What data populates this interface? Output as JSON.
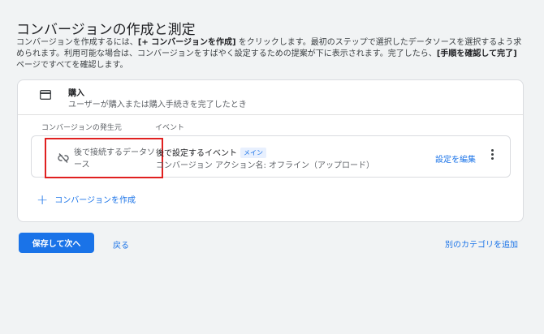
{
  "page": {
    "title": "コンバージョンの作成と測定",
    "description": {
      "p1": "コンバージョンを作成するには、",
      "b1": "[+ コンバージョンを作成]",
      "p2": " をクリックします。最初のステップで選択したデータソースを選択するよう求められます。利用可能な場合は、コンバージョンをすばやく設定するための提案が下に表示されます。完了したら、",
      "b2": "[手順を確認して完了]",
      "p3": " ページですべてを確認します。"
    }
  },
  "category": {
    "icon": "credit-card-icon",
    "title": "購入",
    "subtitle": "ユーザーが購入または購入手続きを完了したとき"
  },
  "table": {
    "source_header": "コンバージョンの発生元",
    "event_header": "イベント"
  },
  "action": {
    "source_icon": "link-off-icon",
    "source_label": "後で接続するデータソース",
    "event_title": "後で設定するイベント",
    "badge": "メイン",
    "event_detail": "コンバージョン アクション名: オフライン（アップロード）",
    "edit_label": "設定を編集"
  },
  "create_label": "コンバージョンを作成",
  "footer": {
    "save_next": "保存して次へ",
    "back": "戻る",
    "add_category": "別のカテゴリを追加"
  },
  "colors": {
    "primary": "#1a73e8",
    "highlight": "#e02020",
    "background": "#f1f3f4"
  }
}
